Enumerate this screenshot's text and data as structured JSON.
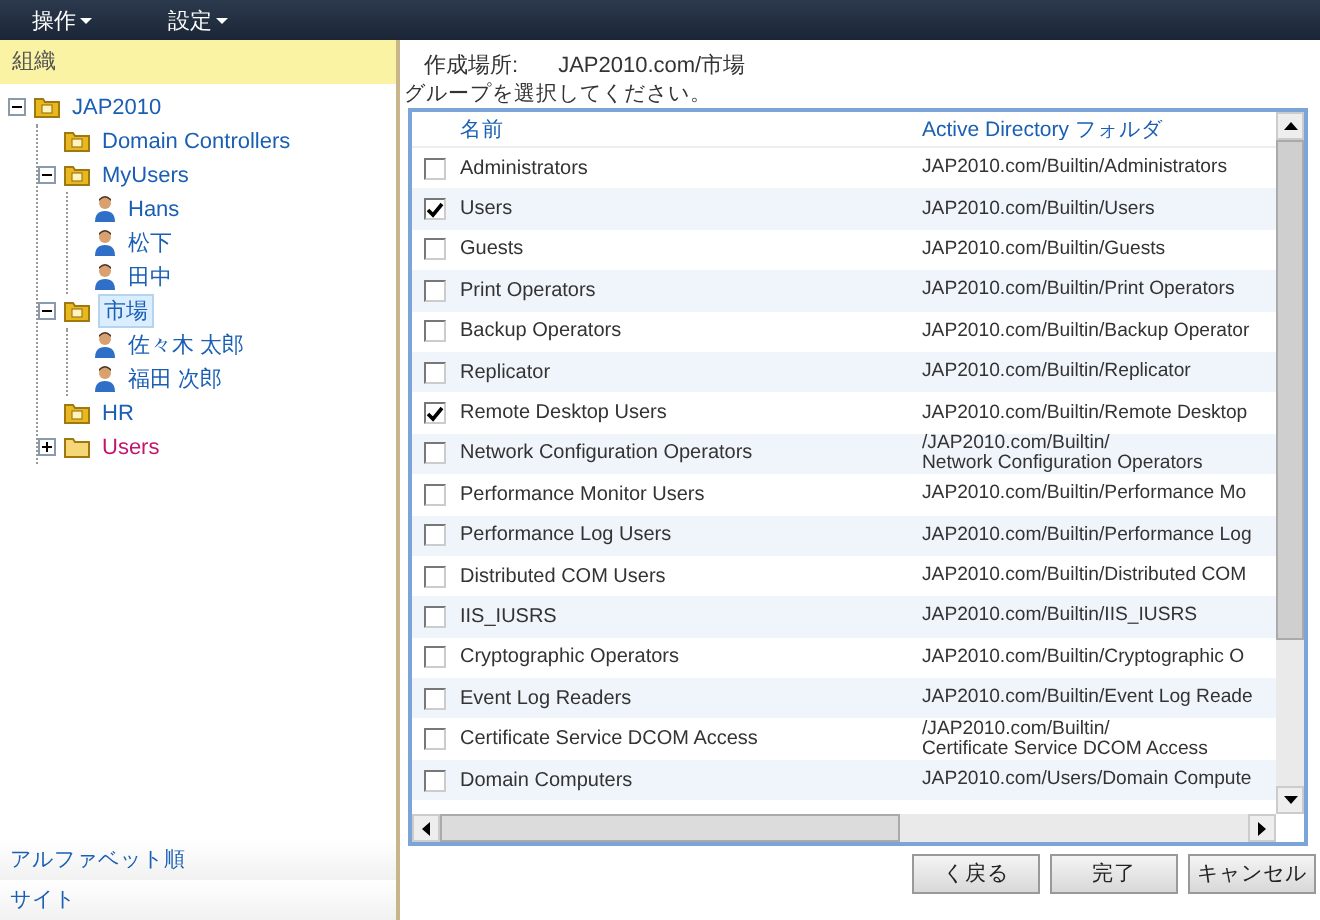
{
  "menu": [
    {
      "label": "操作"
    },
    {
      "label": "設定"
    }
  ],
  "sidebar": {
    "title": "組織",
    "tree": [
      {
        "label": "JAP2010",
        "kind": "folder",
        "expanded": true,
        "selected": false,
        "color": "#1a5fb4",
        "children": [
          {
            "label": "Domain Controllers",
            "kind": "folder",
            "selected": false,
            "color": "#1a5fb4"
          },
          {
            "label": "MyUsers",
            "kind": "folder",
            "expanded": true,
            "selected": false,
            "color": "#1a5fb4",
            "children": [
              {
                "label": "Hans",
                "kind": "user",
                "selected": false,
                "color": "#1a5fb4"
              },
              {
                "label": "松下",
                "kind": "user",
                "selected": false,
                "color": "#1a5fb4"
              },
              {
                "label": "田中",
                "kind": "user",
                "selected": false,
                "color": "#1a5fb4"
              }
            ]
          },
          {
            "label": "市場",
            "kind": "folder",
            "expanded": true,
            "selected": true,
            "color": "#1a5fb4",
            "children": [
              {
                "label": "佐々木 太郎",
                "kind": "user",
                "selected": false,
                "color": "#1a5fb4"
              },
              {
                "label": "福田 次郎",
                "kind": "user",
                "selected": false,
                "color": "#1a5fb4"
              }
            ]
          },
          {
            "label": "HR",
            "kind": "folder",
            "selected": false,
            "color": "#1a5fb4"
          },
          {
            "label": "Users",
            "kind": "container",
            "expanded": false,
            "selected": false,
            "color": "#c0166f"
          }
        ]
      }
    ],
    "links": [
      "アルファベット順",
      "サイト"
    ]
  },
  "location": {
    "label": "作成場所:",
    "value": "JAP2010.com/市場"
  },
  "instruction": "グループを選択してください。",
  "table": {
    "columns": [
      "名前",
      "Active Directory フォルダ"
    ],
    "rows": [
      {
        "checked": false,
        "name": "Administrators",
        "folder": "JAP2010.com/Builtin/Administrators"
      },
      {
        "checked": true,
        "name": "Users",
        "folder": "JAP2010.com/Builtin/Users"
      },
      {
        "checked": false,
        "name": "Guests",
        "folder": "JAP2010.com/Builtin/Guests"
      },
      {
        "checked": false,
        "name": "Print Operators",
        "folder": "JAP2010.com/Builtin/Print Operators"
      },
      {
        "checked": false,
        "name": "Backup Operators",
        "folder": "JAP2010.com/Builtin/Backup Operator"
      },
      {
        "checked": false,
        "name": "Replicator",
        "folder": "JAP2010.com/Builtin/Replicator"
      },
      {
        "checked": true,
        "name": "Remote Desktop Users",
        "folder": "JAP2010.com/Builtin/Remote Desktop"
      },
      {
        "checked": false,
        "name": "Network Configuration Operators",
        "folder": "/JAP2010.com/Builtin/\nNetwork Configuration Operators"
      },
      {
        "checked": false,
        "name": "Performance Monitor Users",
        "folder": "JAP2010.com/Builtin/Performance Mo"
      },
      {
        "checked": false,
        "name": "Performance Log Users",
        "folder": "JAP2010.com/Builtin/Performance Log"
      },
      {
        "checked": false,
        "name": "Distributed COM Users",
        "folder": "JAP2010.com/Builtin/Distributed COM"
      },
      {
        "checked": false,
        "name": "IIS_IUSRS",
        "folder": "JAP2010.com/Builtin/IIS_IUSRS"
      },
      {
        "checked": false,
        "name": "Cryptographic Operators",
        "folder": "JAP2010.com/Builtin/Cryptographic O"
      },
      {
        "checked": false,
        "name": "Event Log Readers",
        "folder": "JAP2010.com/Builtin/Event Log Reade"
      },
      {
        "checked": false,
        "name": "Certificate Service DCOM Access",
        "folder": "/JAP2010.com/Builtin/\nCertificate Service DCOM Access"
      },
      {
        "checked": false,
        "name": "Domain Computers",
        "folder": "JAP2010.com/Users/Domain Compute"
      }
    ]
  },
  "buttons": [
    "く戻る",
    "完了",
    "キャンセル"
  ]
}
